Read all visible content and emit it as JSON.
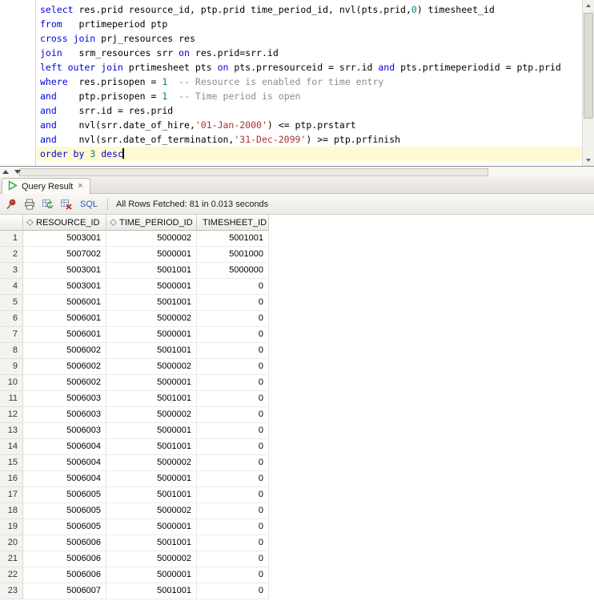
{
  "colors": {
    "keyword": "#0000e0",
    "comment": "#8c8c8c",
    "string": "#a8342a",
    "number": "#007f7f",
    "current_line_bg": "#fdfad1",
    "pin": "#c23b22",
    "play": "#2fa33a",
    "sql_label": "#2a53c9"
  },
  "editor": {
    "current_line_index": 10,
    "lines": [
      {
        "segments": [
          {
            "type": "kw",
            "text": "select"
          },
          {
            "type": "pl",
            "text": " res.prid resource_id, ptp.prid time_period_id, nvl(pts.prid,"
          },
          {
            "type": "nu",
            "text": "0"
          },
          {
            "type": "pl",
            "text": ") timesheet_id"
          }
        ]
      },
      {
        "segments": [
          {
            "type": "kw",
            "text": "from"
          },
          {
            "type": "pl",
            "text": "   prtimeperiod ptp"
          }
        ]
      },
      {
        "segments": [
          {
            "type": "kw",
            "text": "cross join"
          },
          {
            "type": "pl",
            "text": " prj_resources res"
          }
        ]
      },
      {
        "segments": [
          {
            "type": "kw",
            "text": "join"
          },
          {
            "type": "pl",
            "text": "   srm_resources srr "
          },
          {
            "type": "kw",
            "text": "on"
          },
          {
            "type": "pl",
            "text": " res.prid=srr.id"
          }
        ]
      },
      {
        "segments": [
          {
            "type": "kw",
            "text": "left outer join"
          },
          {
            "type": "pl",
            "text": " prtimesheet pts "
          },
          {
            "type": "kw",
            "text": "on"
          },
          {
            "type": "pl",
            "text": " pts.prresourceid = srr.id "
          },
          {
            "type": "kw",
            "text": "and"
          },
          {
            "type": "pl",
            "text": " pts.prtimeperiodid = ptp.prid"
          }
        ]
      },
      {
        "segments": [
          {
            "type": "kw",
            "text": "where"
          },
          {
            "type": "pl",
            "text": "  res.prisopen = "
          },
          {
            "type": "nu",
            "text": "1"
          },
          {
            "type": "pl",
            "text": "  "
          },
          {
            "type": "cm",
            "text": "-- Resource is enabled for time entry"
          }
        ]
      },
      {
        "segments": [
          {
            "type": "kw",
            "text": "and"
          },
          {
            "type": "pl",
            "text": "    ptp.prisopen = "
          },
          {
            "type": "nu",
            "text": "1"
          },
          {
            "type": "pl",
            "text": "  "
          },
          {
            "type": "cm",
            "text": "-- Time period is open"
          }
        ]
      },
      {
        "segments": [
          {
            "type": "kw",
            "text": "and"
          },
          {
            "type": "pl",
            "text": "    srr.id = res.prid"
          }
        ]
      },
      {
        "segments": [
          {
            "type": "kw",
            "text": "and"
          },
          {
            "type": "pl",
            "text": "    nvl(srr.date_of_hire,"
          },
          {
            "type": "st",
            "text": "'01-Jan-2000'"
          },
          {
            "type": "pl",
            "text": ") <= ptp.prstart"
          }
        ]
      },
      {
        "segments": [
          {
            "type": "kw",
            "text": "and"
          },
          {
            "type": "pl",
            "text": "    nvl(srr.date_of_termination,"
          },
          {
            "type": "st",
            "text": "'31-Dec-2099'"
          },
          {
            "type": "pl",
            "text": ") >= ptp.prfinish"
          }
        ]
      },
      {
        "segments": [
          {
            "type": "kw",
            "text": "order by"
          },
          {
            "type": "pl",
            "text": " "
          },
          {
            "type": "nu",
            "text": "3"
          },
          {
            "type": "pl",
            "text": " "
          },
          {
            "type": "kw",
            "text": "desc"
          }
        ]
      }
    ]
  },
  "results": {
    "tab": {
      "label": "Query Result",
      "close": "×"
    },
    "toolbar": {
      "sql_label": "SQL",
      "status": "All Rows Fetched: 81 in 0.013 seconds"
    },
    "grid": {
      "columns": [
        "RESOURCE_ID",
        "TIME_PERIOD_ID",
        "TIMESHEET_ID"
      ],
      "rows": [
        [
          "5003001",
          "5000002",
          "5001001"
        ],
        [
          "5007002",
          "5000001",
          "5001000"
        ],
        [
          "5003001",
          "5001001",
          "5000000"
        ],
        [
          "5003001",
          "5000001",
          "0"
        ],
        [
          "5006001",
          "5001001",
          "0"
        ],
        [
          "5006001",
          "5000002",
          "0"
        ],
        [
          "5006001",
          "5000001",
          "0"
        ],
        [
          "5006002",
          "5001001",
          "0"
        ],
        [
          "5006002",
          "5000002",
          "0"
        ],
        [
          "5006002",
          "5000001",
          "0"
        ],
        [
          "5006003",
          "5001001",
          "0"
        ],
        [
          "5006003",
          "5000002",
          "0"
        ],
        [
          "5006003",
          "5000001",
          "0"
        ],
        [
          "5006004",
          "5001001",
          "0"
        ],
        [
          "5006004",
          "5000002",
          "0"
        ],
        [
          "5006004",
          "5000001",
          "0"
        ],
        [
          "5006005",
          "5001001",
          "0"
        ],
        [
          "5006005",
          "5000002",
          "0"
        ],
        [
          "5006005",
          "5000001",
          "0"
        ],
        [
          "5006006",
          "5001001",
          "0"
        ],
        [
          "5006006",
          "5000002",
          "0"
        ],
        [
          "5006006",
          "5000001",
          "0"
        ],
        [
          "5006007",
          "5001001",
          "0"
        ]
      ]
    }
  }
}
